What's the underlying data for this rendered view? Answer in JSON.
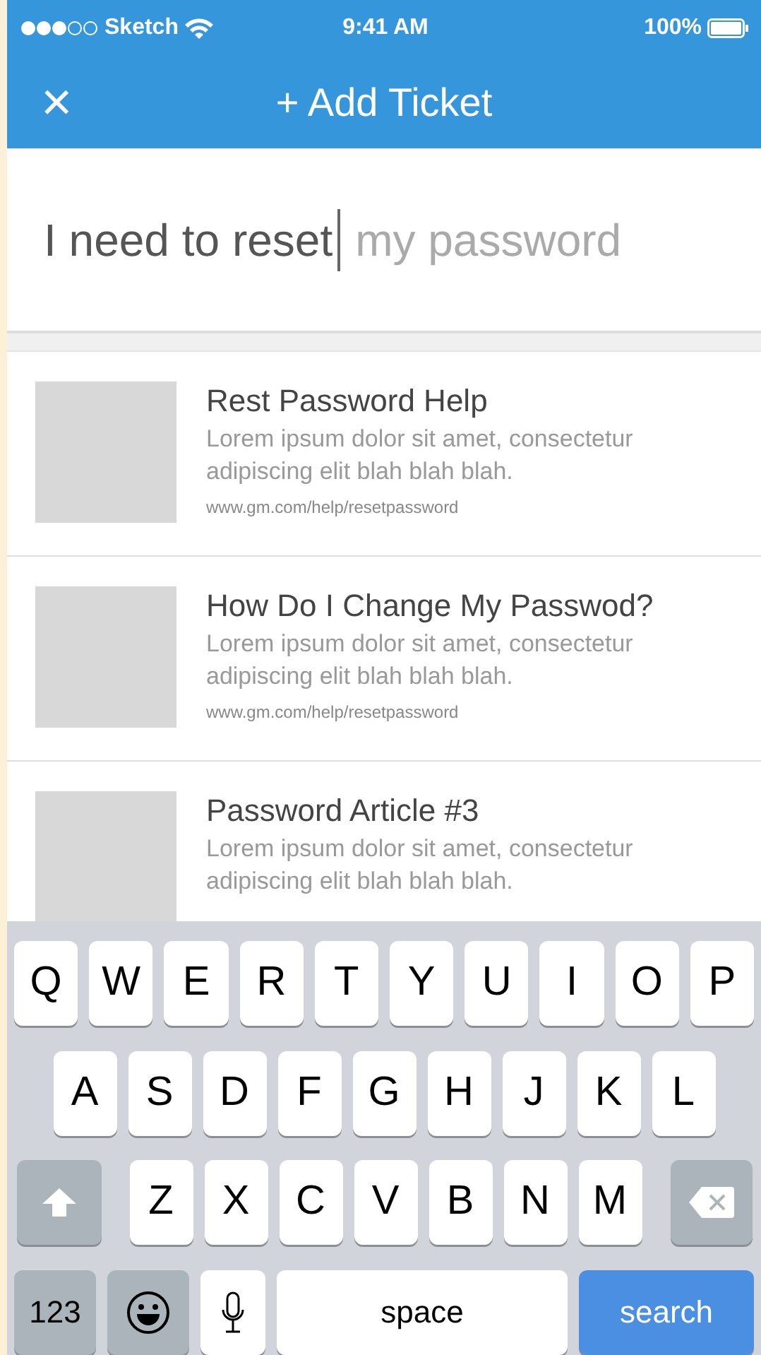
{
  "status_bar": {
    "signal_dots": [
      {
        "filled": true
      },
      {
        "filled": true
      },
      {
        "filled": true
      },
      {
        "filled": false
      },
      {
        "filled": false
      }
    ],
    "carrier": "Sketch",
    "time": "9:41 AM",
    "battery": "100%"
  },
  "nav": {
    "close": "×",
    "title": "+ Add Ticket"
  },
  "search": {
    "value": "I need to reset",
    "suggestion": "my password"
  },
  "articles": [
    {
      "title": "Rest Password Help",
      "description": "Lorem ipsum dolor sit amet, consectetur adipiscing elit blah blah blah.",
      "url": "www.gm.com/help/resetpassword"
    },
    {
      "title": "How Do I Change My Passwod?",
      "description": "Lorem ipsum dolor sit amet, consectetur adipiscing elit blah blah blah.",
      "url": "www.gm.com/help/resetpassword"
    },
    {
      "title": "Password Article #3",
      "description": "Lorem ipsum dolor sit amet, consectetur adipiscing elit blah blah blah."
    }
  ],
  "keyboard": {
    "rows": [
      {
        "keys": [
          {
            "kind": "letter",
            "label": "Q"
          },
          {
            "kind": "letter",
            "label": "W"
          },
          {
            "kind": "letter",
            "label": "E"
          },
          {
            "kind": "letter",
            "label": "R"
          },
          {
            "kind": "letter",
            "label": "T"
          },
          {
            "kind": "letter",
            "label": "Y"
          },
          {
            "kind": "letter",
            "label": "U"
          },
          {
            "kind": "letter",
            "label": "I"
          },
          {
            "kind": "letter",
            "label": "O"
          },
          {
            "kind": "letter",
            "label": "P"
          }
        ]
      },
      {
        "keys": [
          {
            "kind": "letter",
            "label": "A"
          },
          {
            "kind": "letter",
            "label": "S"
          },
          {
            "kind": "letter",
            "label": "D"
          },
          {
            "kind": "letter",
            "label": "F"
          },
          {
            "kind": "letter",
            "label": "G"
          },
          {
            "kind": "letter",
            "label": "H"
          },
          {
            "kind": "letter",
            "label": "J"
          },
          {
            "kind": "letter",
            "label": "K"
          },
          {
            "kind": "letter",
            "label": "L"
          }
        ]
      },
      {
        "keys": [
          {
            "kind": "shift"
          },
          {
            "kind": "letter",
            "label": "Z"
          },
          {
            "kind": "letter",
            "label": "X"
          },
          {
            "kind": "letter",
            "label": "C"
          },
          {
            "kind": "letter",
            "label": "V"
          },
          {
            "kind": "letter",
            "label": "B"
          },
          {
            "kind": "letter",
            "label": "N"
          },
          {
            "kind": "letter",
            "label": "M"
          },
          {
            "kind": "delete"
          }
        ]
      },
      {
        "keys": [
          {
            "kind": "mode",
            "label": "123"
          },
          {
            "kind": "emoji"
          },
          {
            "kind": "mic"
          },
          {
            "kind": "space",
            "label": "space"
          },
          {
            "kind": "action",
            "label": "search"
          }
        ]
      }
    ]
  }
}
